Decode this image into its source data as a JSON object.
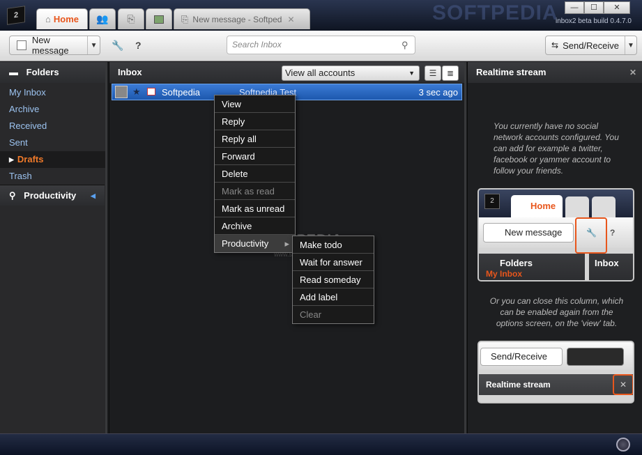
{
  "window": {
    "build": "inbox2 beta build 0.4.7.0",
    "watermark": "SOFTPEDIA",
    "logo": "2",
    "minimize_label": "—",
    "maximize_label": "☐",
    "close_label": "✕"
  },
  "tabs": {
    "home": "Home",
    "message": "New message - Softped",
    "close_label": "✕"
  },
  "toolbar": {
    "new_message": "New message",
    "dropdown_arrow": "▼",
    "settings_icon": "🔧",
    "help": "?",
    "search_placeholder": "Search Inbox",
    "send_receive": "Send/Receive"
  },
  "sidebar": {
    "title": "Folders",
    "items": [
      "My Inbox",
      "Archive",
      "Received",
      "Sent",
      "Drafts",
      "Trash"
    ],
    "selected": "Drafts",
    "productivity": "Productivity"
  },
  "inbox": {
    "title": "Inbox",
    "account_filter": "View all accounts",
    "message": {
      "from": "Softpedia",
      "subject": "Softpedia Test",
      "time": "3 sec ago"
    }
  },
  "context_menu": {
    "items": [
      "View",
      "Reply",
      "Reply all",
      "Forward",
      "Delete",
      "Mark as read",
      "Mark as unread",
      "Archive",
      "Productivity"
    ],
    "disabled": [
      "Mark as read"
    ],
    "highlighted": "Productivity",
    "submenu_arrow": "▸"
  },
  "submenu": {
    "items": [
      "Make todo",
      "Wait for answer",
      "Read someday",
      "Add label",
      "Clear"
    ],
    "disabled": [
      "Clear"
    ]
  },
  "stream": {
    "title": "Realtime stream",
    "close_label": "✕",
    "note1": "You currently have no social network accounts configured. You can add for example a twitter, facebook or yammer account to follow your friends.",
    "note2": "Or you can close this column, which can be enabled again from the options screen, on the 'view' tab.",
    "thumb1": {
      "logo": "2",
      "home": "Home",
      "new_message": "New message",
      "help": "?",
      "folders": "Folders",
      "inbox": "Inbox",
      "my_inbox": "My Inbox"
    },
    "thumb2": {
      "send_receive": "Send/Receive",
      "title": "Realtime stream",
      "close_label": "✕"
    }
  },
  "watermark_overlay": {
    "mark": "SOFTPEDIA",
    "url": "www.softpedia.com"
  },
  "colors": {
    "accent": "#e8561c",
    "selection": "#2a66c2",
    "folder_link": "#9cc3f0"
  }
}
